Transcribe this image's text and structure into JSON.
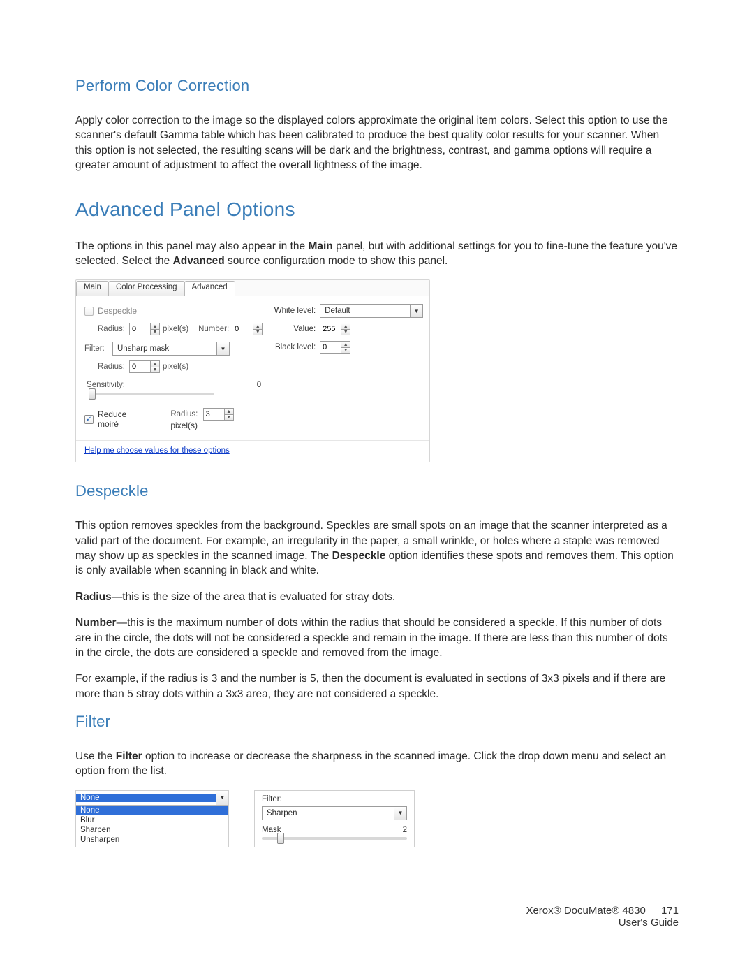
{
  "h_perform": "Perform Color Correction",
  "p_perform": "Apply color correction to the image so the displayed colors approximate the original item colors. Select this option to use the scanner's default Gamma table which has been calibrated to produce the best quality color results for your scanner. When this option is not selected, the resulting scans will be dark and the brightness, contrast, and gamma options will require a greater amount of adjustment to affect the overall lightness of the image.",
  "h_adv": "Advanced Panel Options",
  "p_adv_prefix": "The options in this panel may also appear in the ",
  "p_adv_bold1": "Main",
  "p_adv_mid": " panel, but with additional settings for you to fine-tune the feature you've selected. Select the ",
  "p_adv_bold2": "Advanced",
  "p_adv_suffix": " source configuration mode to show this panel.",
  "panel": {
    "tabs": {
      "main": "Main",
      "colorproc": "Color Processing",
      "advanced": "Advanced"
    },
    "despeckle": {
      "label": "Despeckle",
      "radius_label": "Radius:",
      "radius_value": "0",
      "radius_unit": "pixel(s)",
      "number_label": "Number:",
      "number_value": "0"
    },
    "filter": {
      "label": "Filter:",
      "selected": "Unsharp mask",
      "radius_label": "Radius:",
      "radius_value": "0",
      "radius_unit": "pixel(s)",
      "sensitivity_label": "Sensitivity:",
      "sensitivity_value": "0"
    },
    "moire": {
      "label": "Reduce moiré",
      "radius_label": "Radius:",
      "radius_value": "3",
      "radius_unit": "pixel(s)"
    },
    "right": {
      "white_label": "White level:",
      "white_value": "Default",
      "value_label": "Value:",
      "value_value": "255",
      "black_label": "Black level:",
      "black_value": "0"
    },
    "help": "Help me choose values for these options"
  },
  "h_despeckle": "Despeckle",
  "p_desp1_a": "This option removes speckles from the background. Speckles are small spots on an image that the scanner interpreted as a valid part of the document. For example, an irregularity in the paper, a small wrinkle, or holes where a staple was removed may show up as speckles in the scanned image. The ",
  "p_desp1_bold": "Despeckle",
  "p_desp1_b": " option identifies these spots and removes them. This option is only available when scanning in black and white.",
  "p_radius_bold": "Radius",
  "p_radius_rest": "—this is the size of the area that is evaluated for stray dots.",
  "p_number_bold": "Number",
  "p_number_rest": "—this is the maximum number of dots within the radius that should be considered a speckle. If this number of dots are in the circle, the dots will not be considered a speckle and remain in the image. If there are less than this number of dots in the circle, the dots are considered a speckle and removed from the image.",
  "p_example": "For example, if the radius is 3 and the number is 5, then the document is evaluated in sections of 3x3 pixels and if there are more than 5 stray dots within a 3x3 area, they are not considered a speckle.",
  "h_filter": "Filter",
  "p_filter_a": "Use the ",
  "p_filter_bold": "Filter",
  "p_filter_b": " option to increase or decrease the sharpness in the scanned image. Click the drop down menu and select an option from the list.",
  "filter_dd": {
    "top": "None",
    "options": [
      "None",
      "Blur",
      "Sharpen",
      "Unsharpen"
    ]
  },
  "filter_set": {
    "label": "Filter:",
    "selected": "Sharpen",
    "mask_label": "Mask",
    "mask_value": "2"
  },
  "footer": {
    "product": "Xerox® DocuMate® 4830",
    "guide": "User's Guide",
    "page": "171"
  }
}
